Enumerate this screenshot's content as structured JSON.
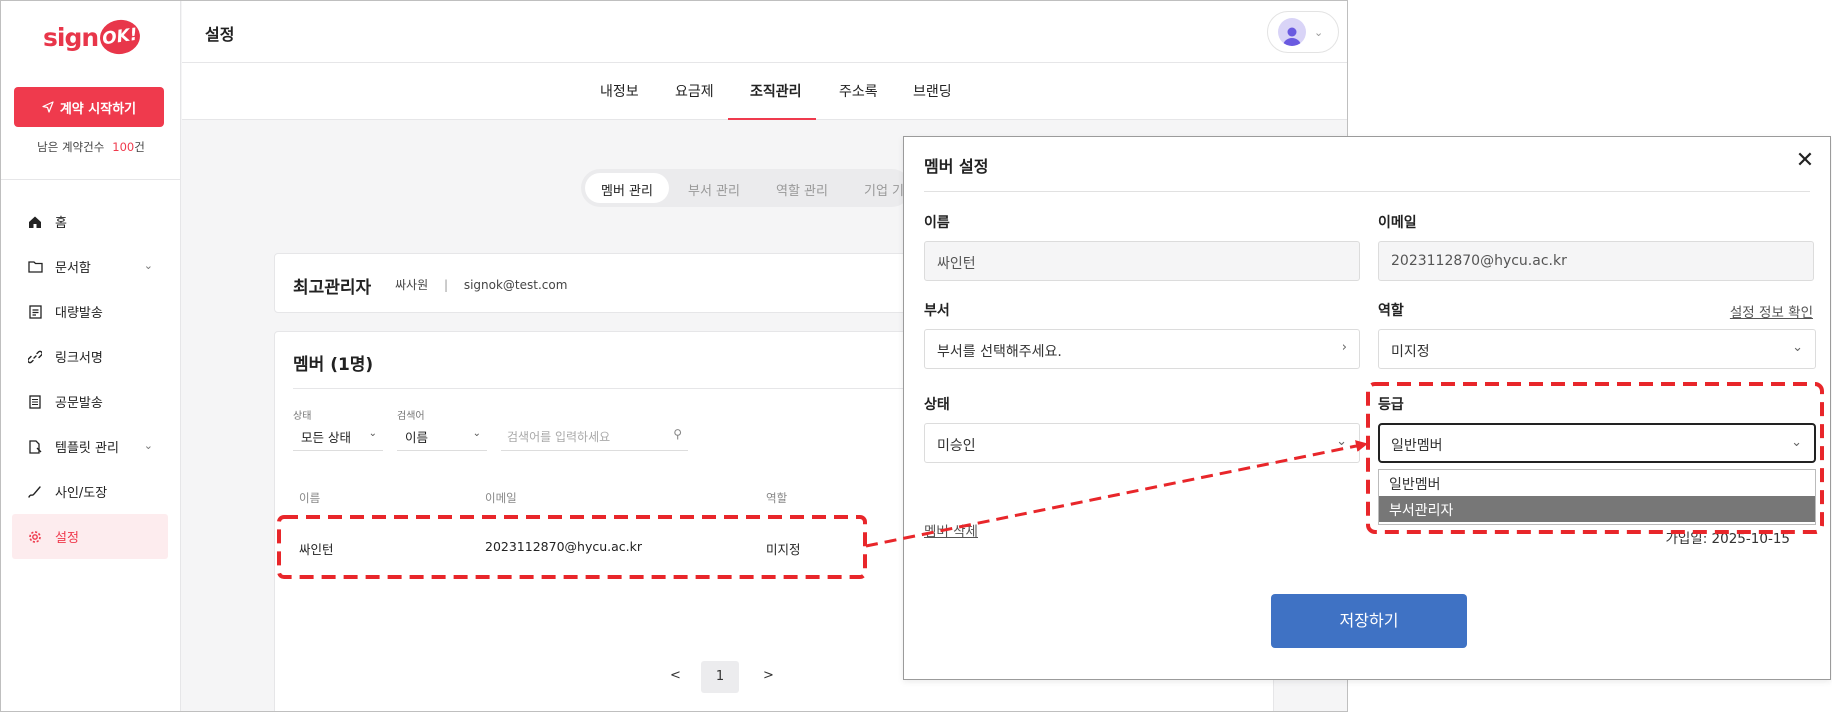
{
  "sidebar": {
    "logo_text": "sign",
    "logo_badge": "OK!",
    "start_button": "계약 시작하기",
    "remain_label": "남은 계약건수",
    "remain_count": "100",
    "remain_unit": "건",
    "items": [
      {
        "label": "홈",
        "icon": "home-icon"
      },
      {
        "label": "문서함",
        "icon": "folder-icon"
      },
      {
        "label": "대량발송",
        "icon": "bulk-send-icon"
      },
      {
        "label": "링크서명",
        "icon": "link-icon"
      },
      {
        "label": "공문발송",
        "icon": "document-icon"
      },
      {
        "label": "템플릿 관리",
        "icon": "template-icon"
      },
      {
        "label": "사인/도장",
        "icon": "signature-icon"
      },
      {
        "label": "설정",
        "icon": "gear-icon"
      }
    ]
  },
  "header": {
    "title": "설정",
    "tabs": [
      "내정보",
      "요금제",
      "조직관리",
      "주소록",
      "브랜딩"
    ],
    "active_tab": "조직관리"
  },
  "subtabs": [
    "멤버 관리",
    "부서 관리",
    "역할 관리",
    "기업 기"
  ],
  "admin_card": {
    "title": "최고관리자",
    "name": "싸사원",
    "separator": "|",
    "email": "signok@test.com"
  },
  "member_card": {
    "title": "멤버 (1명)",
    "filters": {
      "status_label": "상태",
      "status_value": "모든 상태",
      "search_label": "검색어",
      "search_field": "이름",
      "search_placeholder": "검색어를 입력하세요"
    },
    "columns": [
      "이름",
      "이메일",
      "역할"
    ],
    "rows": [
      {
        "name": "싸인턴",
        "email": "2023112870@hycu.ac.kr",
        "role": "미지정"
      }
    ],
    "pager": {
      "prev": "<",
      "current": "1",
      "next": ">"
    }
  },
  "modal": {
    "title": "멤버 설정",
    "close": "✕",
    "name_label": "이름",
    "name_value": "싸인턴",
    "email_label": "이메일",
    "email_value": "2023112870@hycu.ac.kr",
    "dept_label": "부서",
    "dept_value": "부서를 선택해주세요.",
    "role_label": "역할",
    "role_link": "설정 정보 확인",
    "role_value": "미지정",
    "status_label": "상태",
    "status_value": "미승인",
    "grade_label": "등급",
    "grade_value": "일반멤버",
    "grade_options": [
      "일반멤버",
      "부서관리자"
    ],
    "grade_highlighted": "부서관리자",
    "delete_link": "멤버 삭제",
    "joined": "가입일: 2025-10-15",
    "save_button": "저장하기"
  },
  "colors": {
    "brand": "#ef3a4d",
    "save": "#3f72c4",
    "annotation": "#e8262a"
  }
}
